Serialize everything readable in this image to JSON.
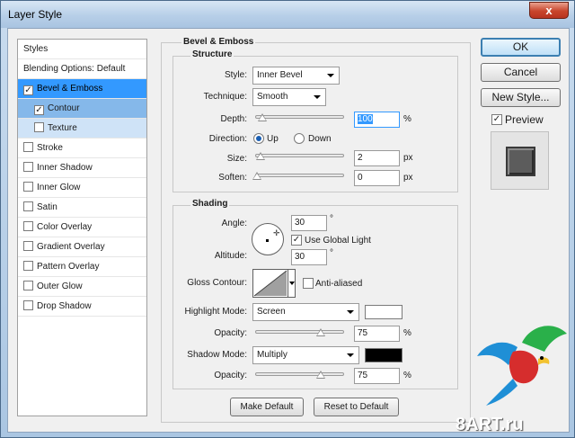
{
  "window": {
    "title": "Layer Style",
    "close": "x"
  },
  "styles_list": {
    "header": "Styles",
    "blending": "Blending Options: Default",
    "items": [
      {
        "label": "Bevel & Emboss",
        "checked": true
      },
      {
        "label": "Contour",
        "checked": true
      },
      {
        "label": "Texture",
        "checked": false
      },
      {
        "label": "Stroke",
        "checked": false
      },
      {
        "label": "Inner Shadow",
        "checked": false
      },
      {
        "label": "Inner Glow",
        "checked": false
      },
      {
        "label": "Satin",
        "checked": false
      },
      {
        "label": "Color Overlay",
        "checked": false
      },
      {
        "label": "Gradient Overlay",
        "checked": false
      },
      {
        "label": "Pattern Overlay",
        "checked": false
      },
      {
        "label": "Outer Glow",
        "checked": false
      },
      {
        "label": "Drop Shadow",
        "checked": false
      }
    ]
  },
  "bevel": {
    "title": "Bevel & Emboss",
    "structure_title": "Structure",
    "style_label": "Style:",
    "style_value": "Inner Bevel",
    "technique_label": "Technique:",
    "technique_value": "Smooth",
    "depth_label": "Depth:",
    "depth_value": "100",
    "depth_unit": "%",
    "direction_label": "Direction:",
    "direction_up": "Up",
    "direction_down": "Down",
    "size_label": "Size:",
    "size_value": "2",
    "size_unit": "px",
    "soften_label": "Soften:",
    "soften_value": "0",
    "soften_unit": "px"
  },
  "shading": {
    "title": "Shading",
    "angle_label": "Angle:",
    "angle_value": "30",
    "angle_unit": "°",
    "global_light": "Use Global Light",
    "altitude_label": "Altitude:",
    "altitude_value": "30",
    "altitude_unit": "°",
    "gloss_label": "Gloss Contour:",
    "anti_aliased": "Anti-aliased",
    "highlight_label": "Highlight Mode:",
    "highlight_value": "Screen",
    "highlight_color": "#ffffff",
    "highlight_opacity_label": "Opacity:",
    "highlight_opacity": "75",
    "shadow_label": "Shadow Mode:",
    "shadow_value": "Multiply",
    "shadow_color": "#000000",
    "shadow_opacity_label": "Opacity:",
    "shadow_opacity": "75",
    "percent": "%"
  },
  "buttons": {
    "make_default": "Make Default",
    "reset_default": "Reset to Default",
    "ok": "OK",
    "cancel": "Cancel",
    "new_style": "New Style...",
    "preview": "Preview"
  },
  "watermark": "8ART.ru"
}
